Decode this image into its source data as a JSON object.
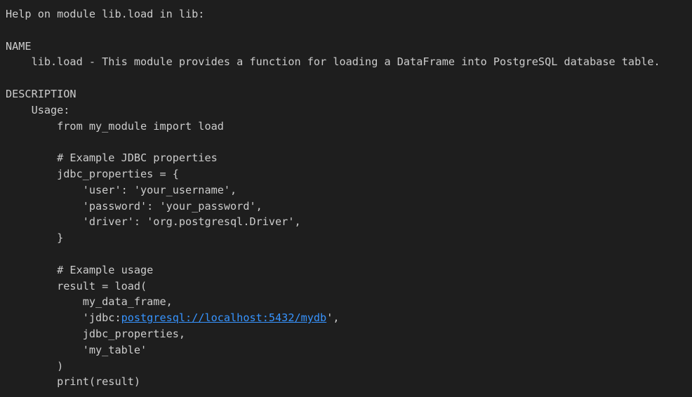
{
  "output": {
    "lines": [
      {
        "text": "Help on module lib.load in lib:"
      },
      {
        "text": ""
      },
      {
        "text": "NAME"
      },
      {
        "text": "    lib.load - This module provides a function for loading a DataFrame into PostgreSQL database table."
      },
      {
        "text": ""
      },
      {
        "text": "DESCRIPTION"
      },
      {
        "text": "    Usage:"
      },
      {
        "text": "        from my_module import load"
      },
      {
        "text": ""
      },
      {
        "text": "        # Example JDBC properties"
      },
      {
        "text": "        jdbc_properties = {"
      },
      {
        "text": "            'user': 'your_username',"
      },
      {
        "text": "            'password': 'your_password',"
      },
      {
        "text": "            'driver': 'org.postgresql.Driver',"
      },
      {
        "text": "        }"
      },
      {
        "text": ""
      },
      {
        "text": "        # Example usage"
      },
      {
        "text": "        result = load("
      },
      {
        "text": "            my_data_frame,"
      },
      {
        "prefix": "            'jdbc:",
        "link": "postgresql://localhost:5432/mydb",
        "suffix": "',"
      },
      {
        "text": "            jdbc_properties,"
      },
      {
        "text": "            'my_table'"
      },
      {
        "text": "        )"
      },
      {
        "text": "        print(result)"
      }
    ]
  },
  "colors": {
    "background": "#1e1e1e",
    "text": "#cccccc",
    "link": "#3794ff"
  }
}
